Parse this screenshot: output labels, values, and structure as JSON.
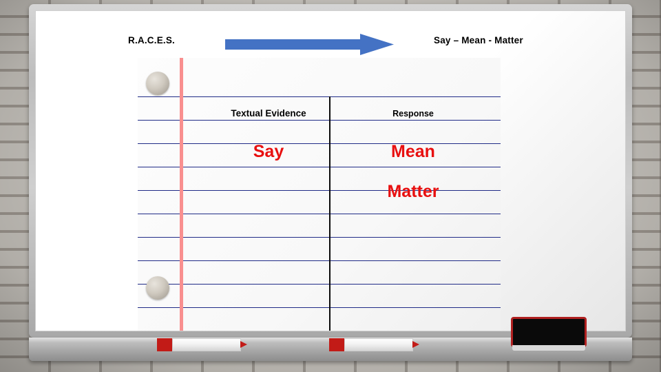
{
  "slide": {
    "header_left": "R.A.C.E.S.",
    "header_right": "Say – Mean - Matter",
    "arrow": {
      "icon": "right-arrow-icon",
      "color": "#4472c4"
    },
    "notebook": {
      "column_headers": [
        "Textual Evidence",
        "Response"
      ],
      "entries": [
        {
          "left": "Say",
          "right": "Mean"
        },
        {
          "left": "",
          "right": "Matter"
        }
      ],
      "accent_color": "#e81010",
      "rule_color": "#1f2a86",
      "margin_color": "#f98f8f"
    }
  },
  "whiteboard": {
    "magnets": [
      "magnet-top",
      "magnet-bottom"
    ],
    "tray_items": [
      "marker-red-1",
      "marker-red-2",
      "whiteboard-eraser"
    ]
  }
}
